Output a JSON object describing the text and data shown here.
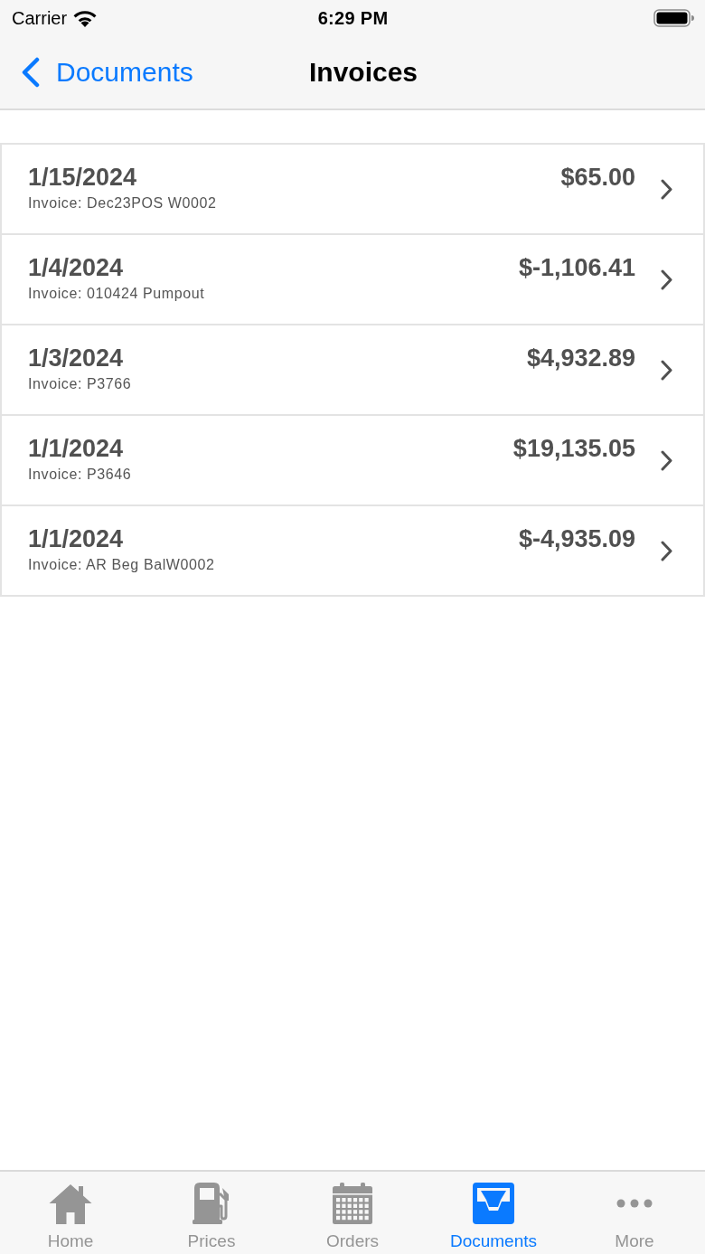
{
  "status_bar": {
    "carrier": "Carrier",
    "time": "6:29 PM"
  },
  "nav_bar": {
    "back_label": "Documents",
    "title": "Invoices"
  },
  "invoices": [
    {
      "date": "1/15/2024",
      "description": "Invoice: Dec23POS W0002",
      "amount": "$65.00"
    },
    {
      "date": "1/4/2024",
      "description": "Invoice: 010424 Pumpout",
      "amount": "$-1,106.41"
    },
    {
      "date": "1/3/2024",
      "description": "Invoice: P3766",
      "amount": "$4,932.89"
    },
    {
      "date": "1/1/2024",
      "description": "Invoice: P3646",
      "amount": "$19,135.05"
    },
    {
      "date": "1/1/2024",
      "description": "Invoice: AR Beg BalW0002",
      "amount": "$-4,935.09"
    }
  ],
  "tab_bar": {
    "tabs": [
      {
        "label": "Home",
        "kind": "home",
        "selected": false
      },
      {
        "label": "Prices",
        "kind": "fuel",
        "selected": false
      },
      {
        "label": "Orders",
        "kind": "calendar",
        "selected": false
      },
      {
        "label": "Documents",
        "kind": "inbox",
        "selected": true
      },
      {
        "label": "More",
        "kind": "more",
        "selected": false
      }
    ]
  }
}
